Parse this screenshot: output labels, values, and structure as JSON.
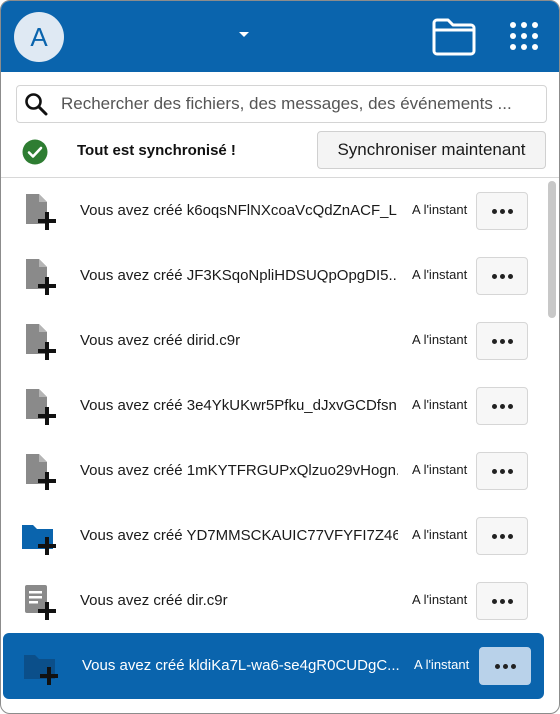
{
  "header": {
    "avatar_letter": "A",
    "accent_color": "#0a64ad",
    "icons": [
      "chevron-down-icon",
      "folder-icon",
      "apps-grid-icon"
    ]
  },
  "search": {
    "placeholder": "Rechercher des fichiers, des messages, des événements ..."
  },
  "status": {
    "text": "Tout est synchronisé !",
    "icon": "check-circle-icon",
    "sync_button_label": "Synchroniser maintenant"
  },
  "activities": [
    {
      "text": "Vous avez créé k6oqsNFlNXcoaVcQdZnACF_L...",
      "time": "A l'instant",
      "icon": "file-add-icon",
      "selected": false
    },
    {
      "text": "Vous avez créé JF3KSqoNpliHDSUQpOpgDI5...",
      "time": "A l'instant",
      "icon": "file-add-icon",
      "selected": false
    },
    {
      "text": "Vous avez créé dirid.c9r",
      "time": "A l'instant",
      "icon": "file-add-icon",
      "selected": false
    },
    {
      "text": "Vous avez créé 3e4YkUKwr5Pfku_dJxvGCDfsn...",
      "time": "A l'instant",
      "icon": "file-add-icon",
      "selected": false
    },
    {
      "text": "Vous avez créé 1mKYTFRGUPxQlzuo29vHogn...",
      "time": "A l'instant",
      "icon": "file-add-icon",
      "selected": false
    },
    {
      "text": "Vous avez créé YD7MMSCKAUIC77VFYFI7Z46...",
      "time": "A l'instant",
      "icon": "folder-add-icon",
      "selected": false
    },
    {
      "text": "Vous avez créé dir.c9r",
      "time": "A l'instant",
      "icon": "text-file-add-icon",
      "selected": false
    },
    {
      "text": "Vous avez créé kldiKa7L-wa6-se4gR0CUDgC...",
      "time": "A l'instant",
      "icon": "folder-add-icon",
      "selected": true
    }
  ]
}
